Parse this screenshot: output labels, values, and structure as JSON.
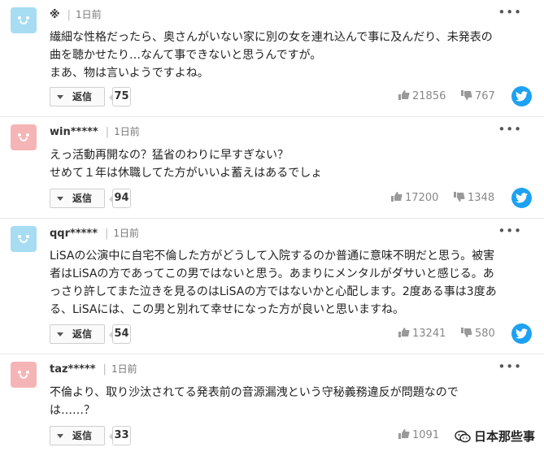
{
  "comments": [
    {
      "user": "※",
      "time": "1日前",
      "avatar_color": "blue",
      "lines": [
        "繊細な性格だったら、奥さんがいない家に別の女を連れ込んで事に及んだり、未発表の",
        "曲を聴かせたり…なんて事できないと思うんですが。",
        "まあ、物は言いようですよね。"
      ],
      "reply_label": "返信",
      "reply_count": "75",
      "likes": "21856",
      "dislikes": "767"
    },
    {
      "user": "win*****",
      "time": "1日前",
      "avatar_color": "pink",
      "lines": [
        "えっ活動再開なの？猛省のわりに早すぎない？",
        "せめて１年は休職してた方がいいよ蓄えはあるでしょ"
      ],
      "reply_label": "返信",
      "reply_count": "94",
      "likes": "17200",
      "dislikes": "1348"
    },
    {
      "user": "qqr*****",
      "time": "1日前",
      "avatar_color": "blue",
      "lines": [
        "LiSAの公演中に自宅不倫した方がどうして入院するのか普通に意味不明だと思う。被害",
        "者はLiSAの方であってこの男ではないと思う。あまりにメンタルがダサいと感じる。あ",
        "っさり許してまた泣きを見るのはLiSAの方ではないかと心配します。2度ある事は3度あ",
        "る、LiSAには、この男と別れて幸せになった方が良いと思いますね。"
      ],
      "reply_label": "返信",
      "reply_count": "54",
      "likes": "13241",
      "dislikes": "580"
    },
    {
      "user": "taz*****",
      "time": "1日前",
      "avatar_color": "pink",
      "lines": [
        "不倫より、取り沙汰されてる発表前の音源漏洩という守秘義務違反が問題なので",
        "は……？"
      ],
      "reply_label": "返信",
      "reply_count": "33",
      "likes": "1091",
      "dislikes": ""
    }
  ],
  "watermark": "日本那些事",
  "colors": {
    "twitter": "#1da1f2",
    "avatar_blue": "#a7dcf3",
    "avatar_pink": "#f5b5b7"
  }
}
